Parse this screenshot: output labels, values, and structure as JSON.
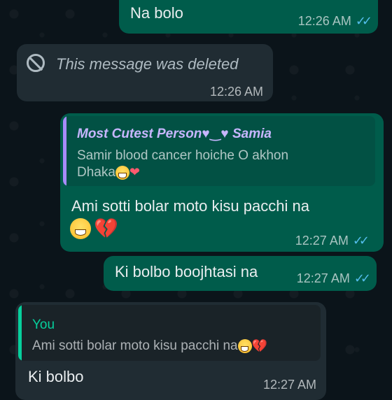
{
  "messages": [
    {
      "id": "m1",
      "direction": "outgoing",
      "text": "Na bolo",
      "time": "12:26 AM",
      "status": "read-double-tick"
    },
    {
      "id": "m2",
      "direction": "incoming",
      "deleted_text": "This message was deleted",
      "time": "12:26 AM",
      "icon": "block-icon"
    },
    {
      "id": "m3",
      "direction": "outgoing",
      "quote": {
        "author": "Most Cutest Person♥‿♥ Samia",
        "text_line1": "Samir blood cancer hoiche O akhon",
        "text_line2": "Dhaka"
      },
      "text": "Ami sotti bolar moto kisu pacchi na",
      "emojis": [
        "sweat-smile-emoji",
        "broken-heart-emoji"
      ],
      "time": "12:27 AM",
      "status": "read-double-tick"
    },
    {
      "id": "m4",
      "direction": "outgoing",
      "text": "Ki bolbo boojhtasi na",
      "time": "12:27 AM",
      "status": "read-double-tick"
    },
    {
      "id": "m5",
      "direction": "incoming",
      "quote": {
        "author": "You",
        "text": "Ami sotti bolar moto kisu pacchi na"
      },
      "text": "Ki bolbo",
      "time": "12:27 AM"
    }
  ],
  "colors": {
    "background": "#0b141a",
    "outgoing_bubble": "#005c4b",
    "incoming_bubble": "#202c33",
    "read_tick": "#53bdeb",
    "quote_purple_bar": "#a78bfa",
    "quote_green_bar": "#06cf9c"
  }
}
